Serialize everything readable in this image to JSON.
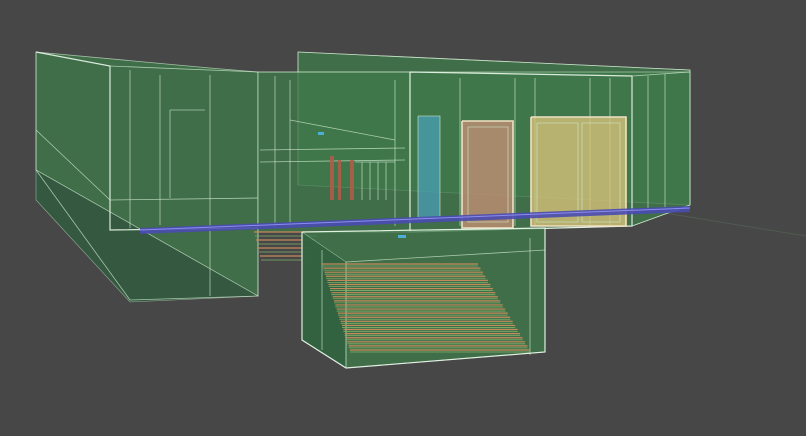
{
  "viewport": {
    "background": "#474747",
    "shading": "wireframe-over-transparent",
    "colors": {
      "glass": "#3f7a4a",
      "glass_dark": "#2d5f3e",
      "edge": "#cfe9cf",
      "edge_strong": "#eaf6ea",
      "floor_slab": "#4a4bb0",
      "stair_tread": "#c48a5c",
      "stair_riser": "#7fb06a",
      "door_left": "#c28e73",
      "door_right": "#d8c37a",
      "window_blue": "#4a9fb6",
      "railing": "#b55a4a",
      "grid_line": "#5a6a5a"
    }
  },
  "scene": {
    "objects": [
      {
        "name": "left-wing-volume"
      },
      {
        "name": "main-volume"
      },
      {
        "name": "rear-wall"
      },
      {
        "name": "right-wing-volume"
      },
      {
        "name": "lower-stair-box"
      },
      {
        "name": "upper-stair"
      },
      {
        "name": "left-door"
      },
      {
        "name": "right-door"
      },
      {
        "name": "blue-window-panel"
      },
      {
        "name": "balcony-railing"
      },
      {
        "name": "floor-slab"
      }
    ]
  }
}
